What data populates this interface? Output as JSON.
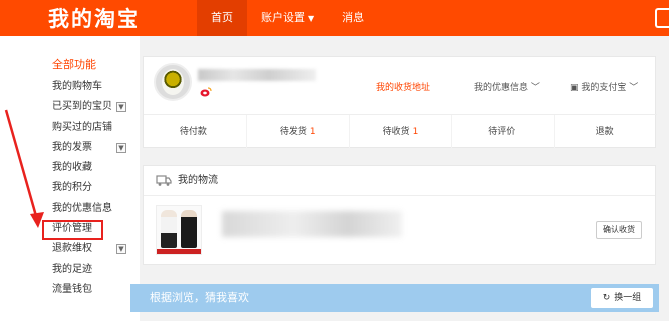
{
  "header": {
    "logo": "我的淘宝",
    "nav": [
      {
        "label": "首页"
      },
      {
        "label": "账户设置"
      },
      {
        "label": "消息"
      }
    ],
    "brand_color": "#ff4a00"
  },
  "sidebar": {
    "title": "全部功能",
    "items": [
      {
        "label": "我的购物车"
      },
      {
        "label": "已买到的宝贝"
      },
      {
        "label": "购买过的店铺"
      },
      {
        "label": "我的发票"
      },
      {
        "label": "我的收藏"
      },
      {
        "label": "我的积分"
      },
      {
        "label": "我的优惠信息"
      },
      {
        "label": "评价管理"
      },
      {
        "label": "退款维权"
      },
      {
        "label": "我的足迹"
      },
      {
        "label": "流量钱包"
      }
    ],
    "highlight_color": "#e8221e"
  },
  "profile": {
    "links": {
      "address": "我的收货地址",
      "coupon": "我的优惠信息",
      "alipay": "我的支付宝"
    },
    "status": [
      {
        "label": "待付款",
        "count": ""
      },
      {
        "label": "待发货",
        "count": "1"
      },
      {
        "label": "待收货",
        "count": "1"
      },
      {
        "label": "待评价",
        "count": ""
      },
      {
        "label": "退款",
        "count": ""
      }
    ]
  },
  "logistics": {
    "title": "我的物流",
    "confirm_label": "确认收货"
  },
  "recommend": {
    "title": "根据浏览，猜我喜欢",
    "refresh_label": "换一组",
    "bar_color": "#9ecbee"
  }
}
